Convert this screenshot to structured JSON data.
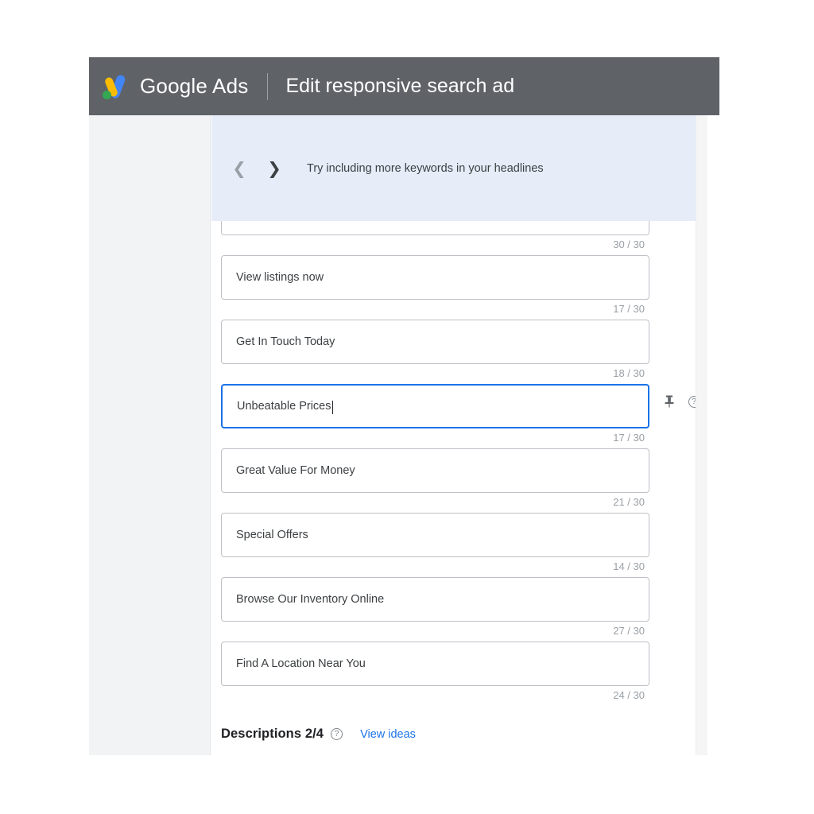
{
  "header": {
    "brand_google": "Google",
    "brand_ads": "Ads",
    "title": "Edit responsive search ad",
    "logo_icon": "google-ads-logo-icon",
    "background_color": "#5f6368"
  },
  "suggestion_banner": {
    "prev_icon": "chevron-left-icon",
    "next_icon": "chevron-right-icon",
    "message": "Try including more keywords in your headlines",
    "background_color": "#e6ecf8"
  },
  "headlines": {
    "partial_top_counter": "30 / 30",
    "items": [
      {
        "value": "View listings now",
        "counter": "17 / 30",
        "focused": false
      },
      {
        "value": "Get In Touch Today",
        "counter": "18 / 30",
        "focused": false
      },
      {
        "value": "Unbeatable Prices",
        "counter": "17 / 30",
        "focused": true,
        "pin_icon": "pin-icon",
        "help_icon": "help-circle-icon"
      },
      {
        "value": "Great Value For Money",
        "counter": "21 / 30",
        "focused": false
      },
      {
        "value": "Special Offers",
        "counter": "14 / 30",
        "focused": false
      },
      {
        "value": "Browse Our Inventory Online",
        "counter": "27 / 30",
        "focused": false
      },
      {
        "value": "Find A Location Near You",
        "counter": "24 / 30",
        "focused": false
      }
    ]
  },
  "descriptions": {
    "title": "Descriptions 2/4",
    "help_icon": "help-circle-icon",
    "view_ideas_label": "View ideas",
    "link_color": "#1a73e8"
  },
  "colors": {
    "focus_border": "#1a73e8",
    "field_border": "#bdc1c6",
    "counter_text": "#9aa0a6",
    "rail_background": "#f1f3f4"
  }
}
